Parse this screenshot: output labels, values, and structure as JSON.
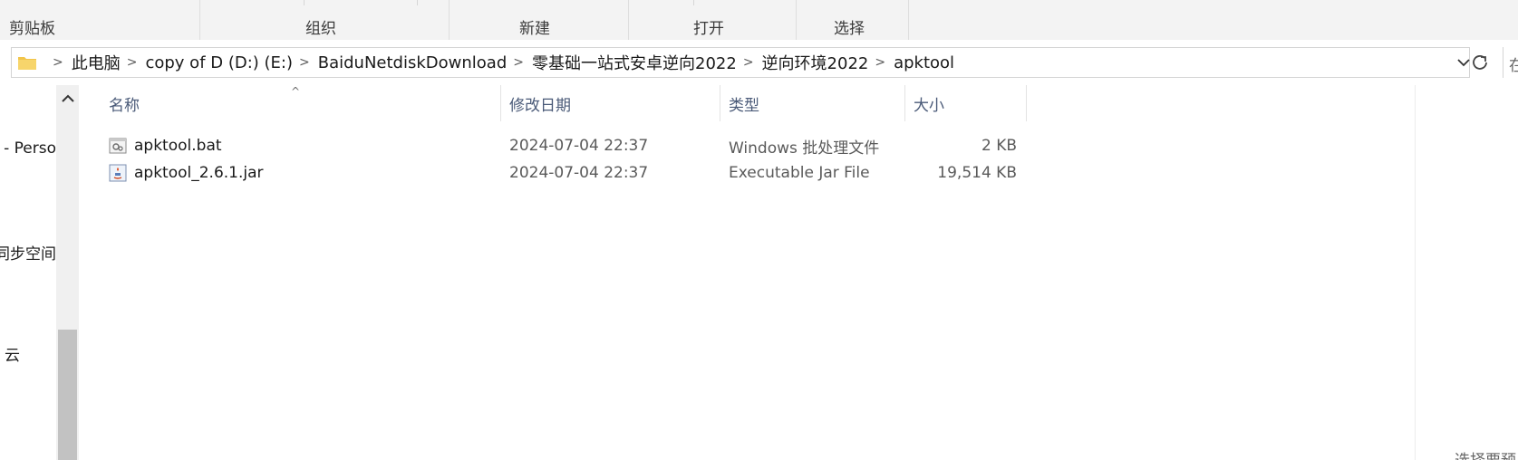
{
  "ribbon": {
    "groups": [
      "剪贴板",
      "组织",
      "新建",
      "打开",
      "选择"
    ]
  },
  "address": {
    "crumbs": [
      "此电脑",
      "copy of D (D:) (E:)",
      "BaiduNetdiskDownload",
      "零基础一站式安卓逆向2022",
      "逆向环境2022",
      "apktool"
    ],
    "right_edge_text": "在"
  },
  "nav": {
    "items": [
      "- Perso",
      "同步空间",
      "云"
    ]
  },
  "columns": {
    "name": "名称",
    "date": "修改日期",
    "type": "类型",
    "size": "大小"
  },
  "files": [
    {
      "name": "apktool.bat",
      "date": "2024-07-04 22:37",
      "type": "Windows 批处理文件",
      "size": "2 KB",
      "icon": "batch-file-icon"
    },
    {
      "name": "apktool_2.6.1.jar",
      "date": "2024-07-04 22:37",
      "type": "Executable Jar File",
      "size": "19,514 KB",
      "icon": "jar-file-icon"
    }
  ],
  "footer": {
    "partial_text": "选择要预"
  },
  "colors": {
    "ribbon_bg": "#f3f3f3",
    "header_text": "#4a5a78",
    "scroll_thumb": "#c2c2c2",
    "folder": "#f2c54a"
  }
}
